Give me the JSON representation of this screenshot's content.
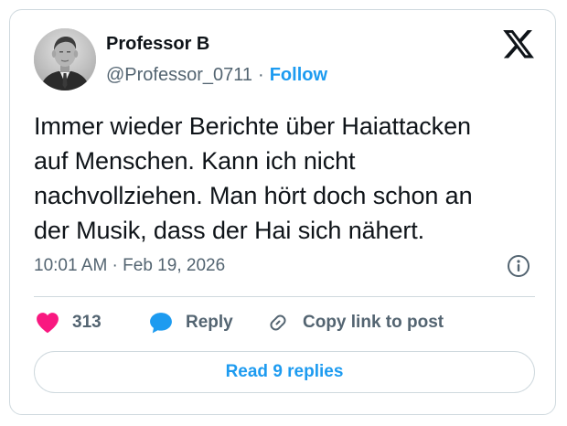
{
  "author": {
    "display_name": "Professor B",
    "handle": "@Professor_0711",
    "separator": "·",
    "follow_label": "Follow",
    "avatar_icon": "avatar-photo"
  },
  "brand": {
    "logo_icon": "x-logo-icon"
  },
  "tweet": {
    "lines": [
      "Immer wieder Berichte über Haiattacken",
      "auf Menschen. Kann ich nicht",
      "nachvollziehen. Man hört doch schon an",
      "der Musik, dass der Hai sich nähert."
    ],
    "timestamp": "10:01 AM · Feb 19, 2026",
    "info_icon": "info-icon"
  },
  "actions": {
    "like_count": "313",
    "like_icon": "heart-icon",
    "like_color": "#f91880",
    "reply_label": "Reply",
    "reply_icon": "speech-bubble-icon",
    "reply_color": "#1d9bf0",
    "copy_label": "Copy link to post",
    "copy_icon": "link-icon"
  },
  "footer": {
    "read_replies_label": "Read 9 replies"
  },
  "colors": {
    "accent": "#1d9bf0",
    "text": "#0f1419",
    "muted": "#536471",
    "border": "#cfd9de"
  }
}
